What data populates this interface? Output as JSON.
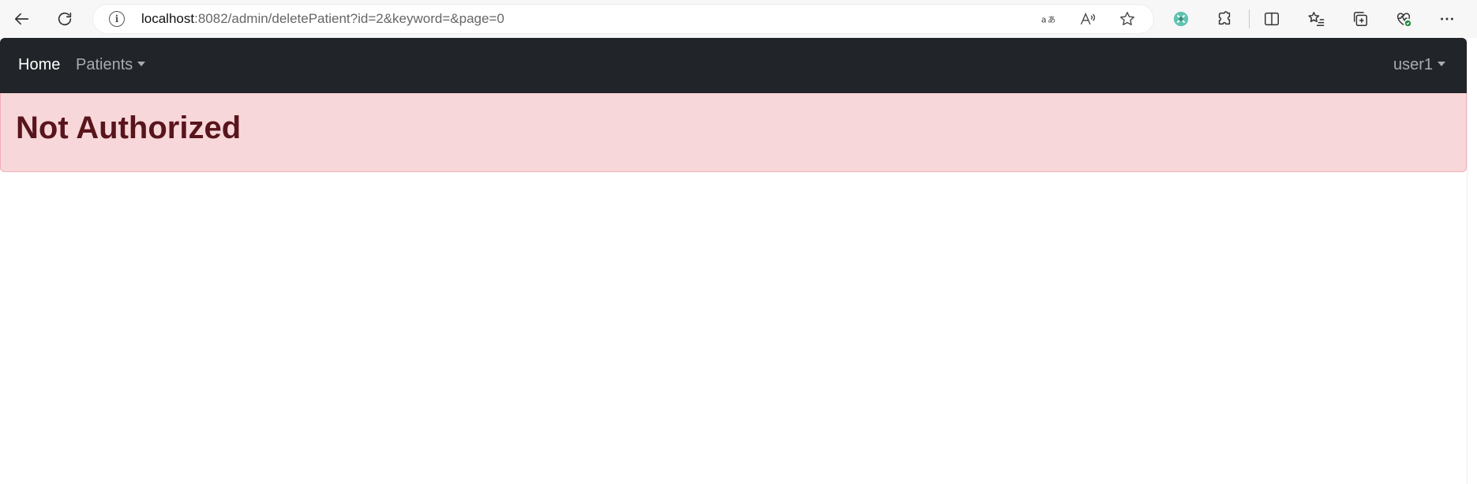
{
  "browser": {
    "url_host": "localhost",
    "url_rest": ":8082/admin/deletePatient?id=2&keyword=&page=0",
    "icons": [
      "back-icon",
      "reload-icon",
      "site-info-icon",
      "translate-icon",
      "read-aloud-icon",
      "favorite-star-icon",
      "extension-colorful-icon",
      "extensions-puzzle-icon",
      "split-screen-icon",
      "favorites-list-icon",
      "collections-icon",
      "browser-essentials-icon",
      "more-menu-icon"
    ]
  },
  "navbar": {
    "home_label": "Home",
    "patients_label": "Patients",
    "user_label": "user1",
    "bg_color": "#212529"
  },
  "alert": {
    "heading": "Not Authorized",
    "bg_color": "#f8d7da",
    "text_color": "#58151c"
  }
}
